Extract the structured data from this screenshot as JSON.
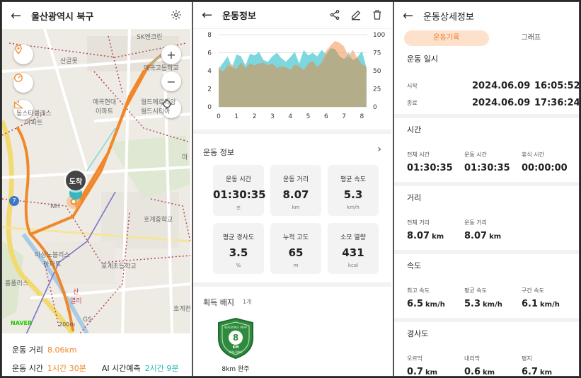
{
  "panel1": {
    "title": "울산광역시 북구",
    "back_icon": "arrow-left-icon",
    "settings_icon": "gear-icon",
    "map": {
      "labels": {
        "sk": "SK엔크린",
        "sanalbang": "산골못",
        "maegok_high": "매곡고등학교",
        "maegok_apt": "매곡현대\n아파트",
        "world_apt": "월드메르디앙\n월드시티아",
        "dongstar": "동스타클래스\n아파트",
        "nh": "NH",
        "hogye_mid": "호계중학교",
        "hogye_el": "호계초등학교",
        "ma": "마",
        "sungno": "이성노블리스\n아파트",
        "homeplus": "홈플러스",
        "train": "산\n열리",
        "gs": "GS",
        "hogyecheon": "호계천",
        "badge7": "7"
      },
      "dest_label": "도착",
      "zoom_in": "+",
      "zoom_out": "−",
      "naver": "NAVER",
      "scale": "200m",
      "route_color": "#f0882a"
    },
    "info": {
      "distance_label": "운동 거리",
      "distance_value": "8.06km",
      "time_label": "운동 시간",
      "time_value": "1시간 30분",
      "ai_label": "AI 시간예측",
      "ai_value": "2시간 9분"
    }
  },
  "panel2": {
    "title": "운동정보",
    "icons": [
      "share-icon",
      "edit-icon",
      "trash-icon"
    ],
    "chart_data": {
      "type": "area",
      "x_ticks": [
        "0",
        "1",
        "2",
        "3",
        "4",
        "5",
        "6",
        "7",
        "8"
      ],
      "y_left_ticks": [
        "8",
        "6",
        "4",
        "2",
        "0"
      ],
      "y_right_ticks": [
        "100",
        "75",
        "50",
        "25",
        "0"
      ],
      "x": [
        0,
        0.25,
        0.5,
        0.75,
        1,
        1.25,
        1.5,
        1.75,
        2,
        2.25,
        2.5,
        2.75,
        3,
        3.25,
        3.5,
        3.75,
        4,
        4.25,
        4.5,
        4.75,
        5,
        5.25,
        5.5,
        5.75,
        6,
        6.25,
        6.5,
        6.75,
        7,
        7.25,
        7.5,
        7.75,
        8,
        8.25
      ],
      "series": [
        {
          "values": [
            4.2,
            4.9,
            5.6,
            4.4,
            5.8,
            5.6,
            4.6,
            5.9,
            5.7,
            6.1,
            5.2,
            5.0,
            5.6,
            6.0,
            5.4,
            5.0,
            5.5,
            6.1,
            4.8,
            6.3,
            5.7,
            6.0,
            5.6,
            6.3,
            5.8,
            6.5,
            6.4,
            5.6,
            5.3,
            6.0,
            5.2,
            5.5,
            6.2,
            4.4
          ],
          "color": "#6ed3dc"
        },
        {
          "values": [
            4.5,
            3.9,
            4.6,
            4.7,
            4.2,
            4.9,
            4.3,
            4.8,
            4.6,
            4.8,
            4.9,
            4.6,
            4.8,
            4.3,
            4.5,
            4.4,
            4.1,
            4.7,
            4.5,
            4.1,
            4.8,
            5.1,
            4.4,
            4.9,
            6.2,
            6.8,
            7.3,
            7.1,
            6.7,
            5.6,
            6.3,
            5.4,
            4.7,
            4.5
          ],
          "color": "#f5b07c"
        }
      ],
      "xlim": [
        0,
        8.3
      ],
      "ylim_left": [
        0,
        8
      ],
      "ylim_right": [
        0,
        100
      ]
    },
    "section_title": "운동 정보",
    "chevron_icon": "chevron-right-icon",
    "stats": [
      {
        "label": "운동 시간",
        "value": "01:30:35",
        "unit": "초"
      },
      {
        "label": "운동 거리",
        "value": "8.07",
        "unit": "km"
      },
      {
        "label": "평균 속도",
        "value": "5.3",
        "unit": "km/h"
      },
      {
        "label": "평균 경사도",
        "value": "3.5",
        "unit": "%"
      },
      {
        "label": "누적 고도",
        "value": "65",
        "unit": "m"
      },
      {
        "label": "소모 열량",
        "value": "431",
        "unit": "kcal"
      }
    ],
    "badge_title": "획득 배지",
    "badge_count": "1개",
    "badge": {
      "top_text": "WALKING MAP",
      "number": "8",
      "unit": "KM",
      "bottom_text": "WALKING",
      "caption": "8km 완주",
      "color": "#2e8b3d"
    }
  },
  "panel3": {
    "title": "운동상세정보",
    "tabs": [
      {
        "label": "운동기록",
        "active": true
      },
      {
        "label": "그래프",
        "active": false
      }
    ],
    "datetime": {
      "title": "운동 일시",
      "start_label": "시작",
      "start_date": "2024.06.09",
      "start_time": "16:05:52",
      "end_label": "종료",
      "end_date": "2024.06.09",
      "end_time": "17:36:24"
    },
    "time": {
      "title": "시간",
      "cells": [
        {
          "label": "전체 시간",
          "value": "01:30:35",
          "unit": ""
        },
        {
          "label": "운동 시간",
          "value": "01:30:35",
          "unit": ""
        },
        {
          "label": "휴식 시간",
          "value": "00:00:00",
          "unit": ""
        }
      ]
    },
    "distance": {
      "title": "거리",
      "cells": [
        {
          "label": "전체 거리",
          "value": "8.07",
          "unit": "km"
        },
        {
          "label": "운동 거리",
          "value": "8.07",
          "unit": "km"
        }
      ]
    },
    "speed": {
      "title": "속도",
      "cells": [
        {
          "label": "최고 속도",
          "value": "6.5",
          "unit": "km/h"
        },
        {
          "label": "평균 속도",
          "value": "5.3",
          "unit": "km/h"
        },
        {
          "label": "구간 속도",
          "value": "6.1",
          "unit": "km/h"
        }
      ]
    },
    "slope": {
      "title": "경사도",
      "cells": [
        {
          "label": "오르막",
          "value": "0.7",
          "unit": "km"
        },
        {
          "label": "내리막",
          "value": "0.6",
          "unit": "km"
        },
        {
          "label": "평지",
          "value": "6.7",
          "unit": "km"
        }
      ]
    }
  }
}
